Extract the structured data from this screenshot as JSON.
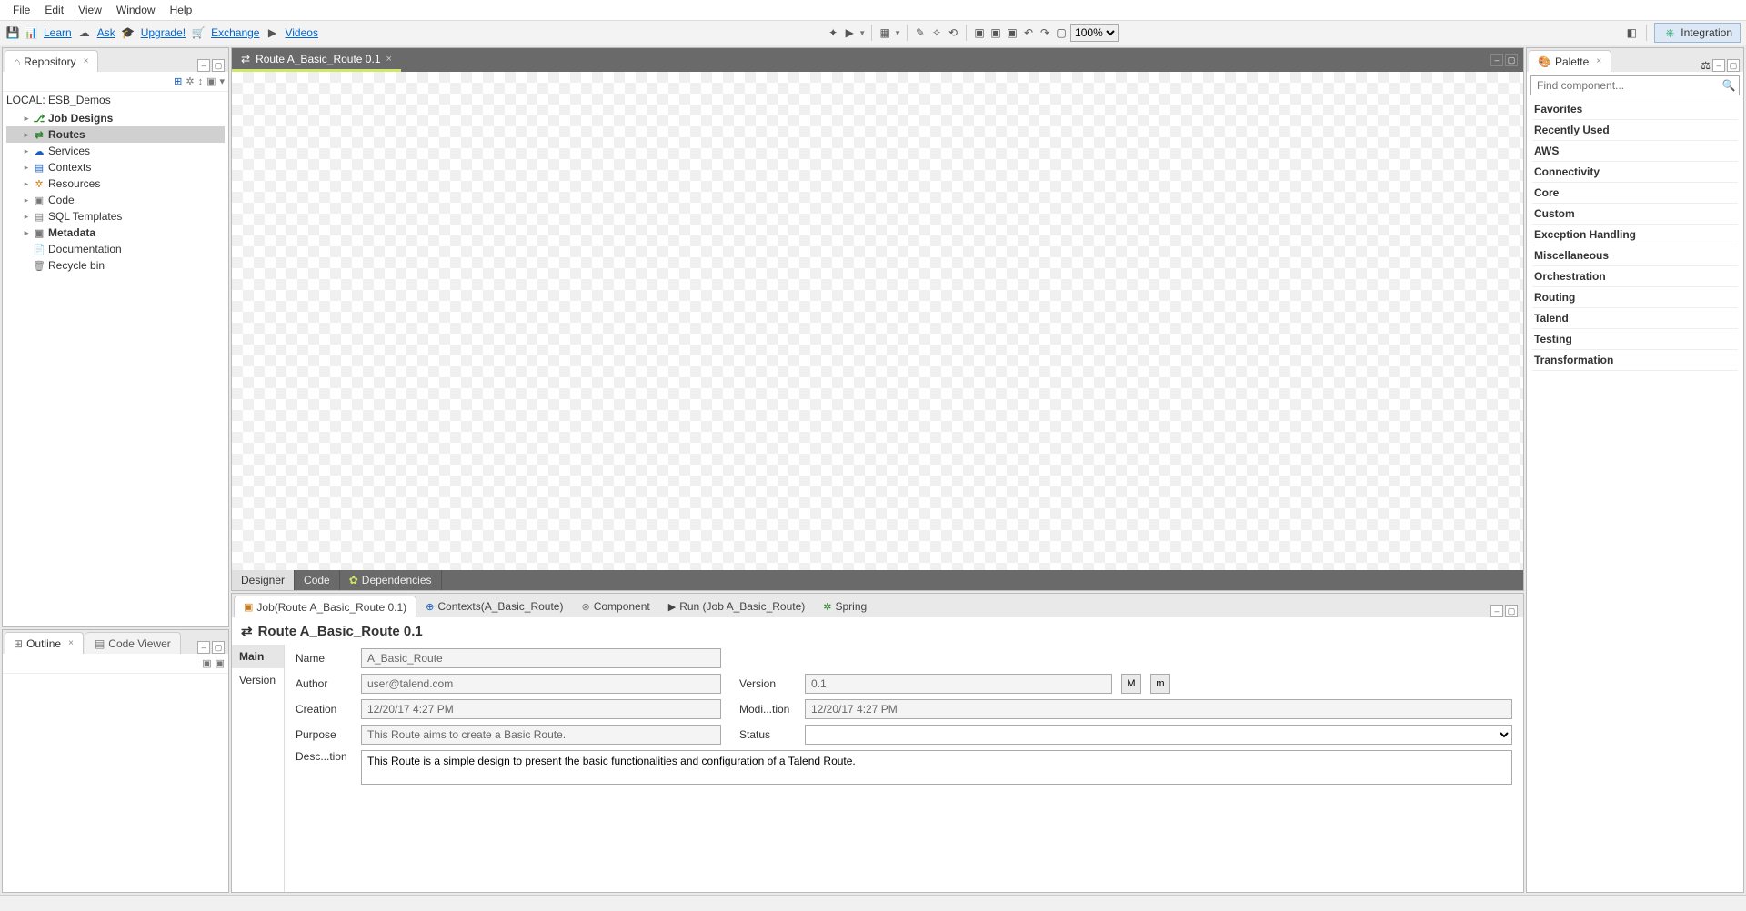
{
  "menu": {
    "file": "File",
    "edit": "Edit",
    "view": "View",
    "window": "Window",
    "help": "Help"
  },
  "toolbar": {
    "learn": "Learn",
    "ask": "Ask",
    "upgrade": "Upgrade!",
    "exchange": "Exchange",
    "videos": "Videos",
    "zoom": "100%",
    "perspective": "Integration"
  },
  "repository": {
    "tab": "Repository",
    "local_label": "LOCAL: ESB_Demos",
    "items": [
      {
        "label": "Job Designs",
        "bold": true
      },
      {
        "label": "Routes",
        "bold": true,
        "selected": true
      },
      {
        "label": "Services"
      },
      {
        "label": "Contexts"
      },
      {
        "label": "Resources"
      },
      {
        "label": "Code"
      },
      {
        "label": "SQL Templates"
      },
      {
        "label": "Metadata",
        "bold": true
      },
      {
        "label": "Documentation",
        "noarrow": true
      },
      {
        "label": "Recycle bin",
        "noarrow": true
      }
    ]
  },
  "outline": {
    "tab": "Outline",
    "code_tab": "Code Viewer"
  },
  "editor": {
    "tab": "Route A_Basic_Route 0.1",
    "bottom_tabs": {
      "designer": "Designer",
      "code": "Code",
      "dependencies": "Dependencies"
    }
  },
  "props": {
    "tabs": {
      "job": "Job(Route A_Basic_Route 0.1)",
      "contexts": "Contexts(A_Basic_Route)",
      "component": "Component",
      "run": "Run (Job A_Basic_Route)",
      "spring": "Spring"
    },
    "title": "Route A_Basic_Route 0.1",
    "side": {
      "main": "Main",
      "version_tab": "Version"
    },
    "labels": {
      "name": "Name",
      "author": "Author",
      "creation": "Creation",
      "purpose": "Purpose",
      "description": "Desc...tion",
      "version": "Version",
      "modification": "Modi...tion",
      "status": "Status"
    },
    "values": {
      "name": "A_Basic_Route",
      "author": "user@talend.com",
      "creation": "12/20/17 4:27 PM",
      "purpose": "This Route aims to create a Basic Route.",
      "version": "0.1",
      "modification": "12/20/17 4:27 PM",
      "status": "",
      "description": "This Route is a simple design to present the basic functionalities and configuration of a Talend Route.",
      "btn_major": "M",
      "btn_minor": "m"
    }
  },
  "palette": {
    "tab": "Palette",
    "search_placeholder": "Find component...",
    "categories": [
      "Favorites",
      "Recently Used",
      "AWS",
      "Connectivity",
      "Core",
      "Custom",
      "Exception Handling",
      "Miscellaneous",
      "Orchestration",
      "Routing",
      "Talend",
      "Testing",
      "Transformation"
    ]
  }
}
